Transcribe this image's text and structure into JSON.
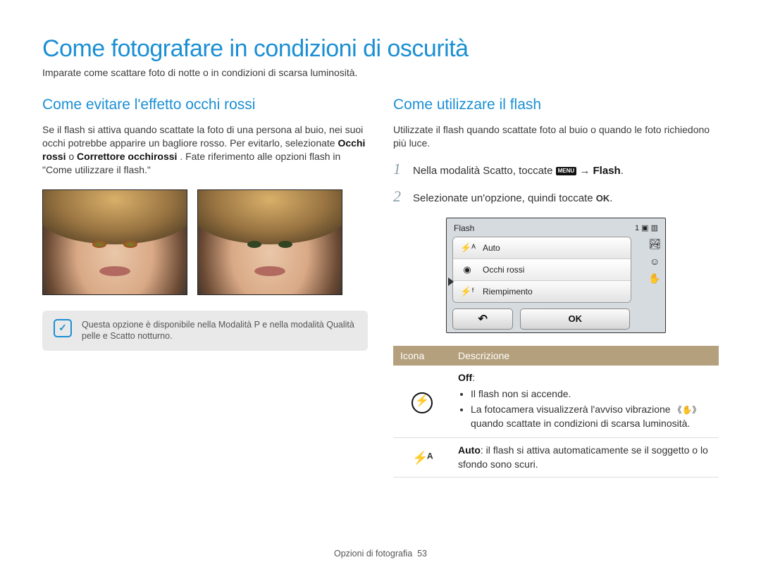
{
  "title": "Come fotografare in condizioni di oscurità",
  "intro": "Imparate come scattare foto di notte o in condizioni di scarsa luminosità.",
  "left": {
    "subhead": "Come evitare l'effetto occhi rossi",
    "para_pre": "Se il flash si attiva quando scattate la foto di una persona al buio, nei suoi occhi potrebbe apparire un bagliore rosso. Per evitarlo, selezionate ",
    "para_b1": "Occhi rossi",
    "para_mid": " o ",
    "para_b2": "Correttore occhirossi",
    "para_post": ". Fate riferimento alle opzioni flash in \"Come utilizzare il flash.\"",
    "note": "Questa opzione è disponibile nella Modalità P e nella modalità Qualità pelle e Scatto notturno."
  },
  "right": {
    "subhead": "Come utilizzare il flash",
    "para": "Utilizzate il flash quando scattate foto al buio o quando le foto richiedono più luce.",
    "step1_pre": "Nella modalità Scatto, toccate ",
    "step1_menu": "MENU",
    "step1_post": " → ",
    "step1_bold": "Flash",
    "step1_end": ".",
    "step2_pre": "Selezionate un'opzione, quindi toccate ",
    "step2_ok": "OK",
    "step2_end": ".",
    "camera": {
      "title": "Flash",
      "count": "1",
      "opts": [
        "Auto",
        "Occhi rossi",
        "Riempimento"
      ],
      "ok": "OK"
    },
    "table": {
      "head_icon": "Icona",
      "head_desc": "Descrizione",
      "row1_title": "Off",
      "row1_b1": "Il flash non si accende.",
      "row1_b2_pre": "La fotocamera visualizzerà l'avviso vibrazione ",
      "row1_b2_post": " quando scattate in condizioni di scarsa luminosità.",
      "row2_bold": "Auto",
      "row2_rest": ": il flash si attiva automaticamente se il soggetto o lo sfondo sono scuri."
    }
  },
  "footer_label": "Opzioni di fotografia",
  "footer_page": "53"
}
